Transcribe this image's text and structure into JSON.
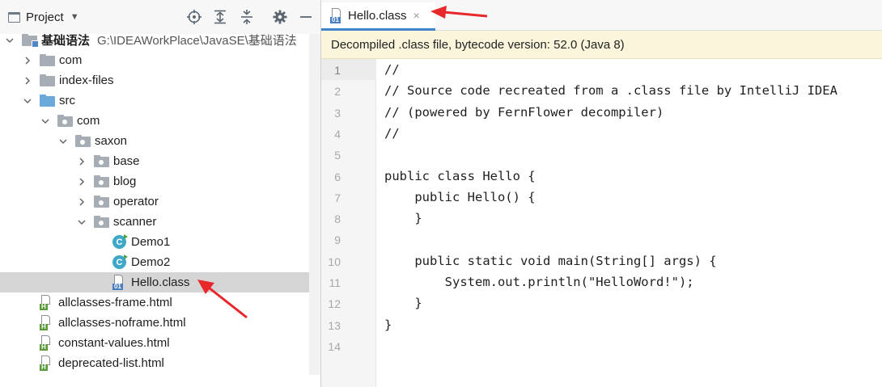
{
  "project_panel": {
    "title": "Project",
    "caret": "▼",
    "toolbar_icons": [
      "crosshair-icon",
      "expand-all-icon",
      "collapse-all-icon",
      "gear-icon",
      "minimize-icon"
    ],
    "tree": [
      {
        "label": "基础语法",
        "path": "G:\\IDEAWorkPlace\\JavaSE\\基础语法",
        "icon": "module-folder-icon",
        "depth": 0,
        "state": "expanded"
      },
      {
        "label": "com",
        "icon": "folder-icon",
        "depth": 1,
        "state": "collapsed"
      },
      {
        "label": "index-files",
        "icon": "folder-icon",
        "depth": 1,
        "state": "collapsed"
      },
      {
        "label": "src",
        "icon": "source-folder-icon",
        "depth": 1,
        "state": "expanded"
      },
      {
        "label": "com",
        "icon": "package-icon",
        "depth": 2,
        "state": "expanded"
      },
      {
        "label": "saxon",
        "icon": "package-icon",
        "depth": 3,
        "state": "expanded"
      },
      {
        "label": "base",
        "icon": "package-icon",
        "depth": 4,
        "state": "collapsed"
      },
      {
        "label": "blog",
        "icon": "package-icon",
        "depth": 4,
        "state": "collapsed"
      },
      {
        "label": "operator",
        "icon": "package-icon",
        "depth": 4,
        "state": "collapsed"
      },
      {
        "label": "scanner",
        "icon": "package-icon",
        "depth": 4,
        "state": "expanded"
      },
      {
        "label": "Demo1",
        "icon": "java-class-icon",
        "depth": 5,
        "state": "leaf"
      },
      {
        "label": "Demo2",
        "icon": "java-class-icon",
        "depth": 5,
        "state": "leaf"
      },
      {
        "label": "Hello.class",
        "icon": "class-file-icon",
        "depth": 5,
        "state": "leaf",
        "selected": true
      },
      {
        "label": "allclasses-frame.html",
        "icon": "html-file-icon",
        "depth": 1,
        "state": "leaf"
      },
      {
        "label": "allclasses-noframe.html",
        "icon": "html-file-icon",
        "depth": 1,
        "state": "leaf"
      },
      {
        "label": "constant-values.html",
        "icon": "html-file-icon",
        "depth": 1,
        "state": "leaf"
      },
      {
        "label": "deprecated-list.html",
        "icon": "html-file-icon",
        "depth": 1,
        "state": "leaf"
      }
    ]
  },
  "icon_tags": {
    "class_file": "01",
    "html_file": "H",
    "java_class": "C"
  },
  "editor": {
    "tab": {
      "label": "Hello.class",
      "close": "×"
    },
    "banner": "Decompiled .class file, bytecode version: 52.0 (Java 8)",
    "current_line": 1,
    "lines": [
      "//",
      "// Source code recreated from a .class file by IntelliJ IDEA",
      "// (powered by FernFlower decompiler)",
      "//",
      "",
      "public class Hello {",
      "    public Hello() {",
      "    }",
      "",
      "    public static void main(String[] args) {",
      "        System.out.println(\"HelloWord!\");",
      "    }",
      "}",
      ""
    ]
  },
  "colors": {
    "selection": "#d5d5d5",
    "banner_bg": "#fbf5dc",
    "tab_underline": "#4083c9",
    "annotation_arrow": "#e8282b"
  }
}
